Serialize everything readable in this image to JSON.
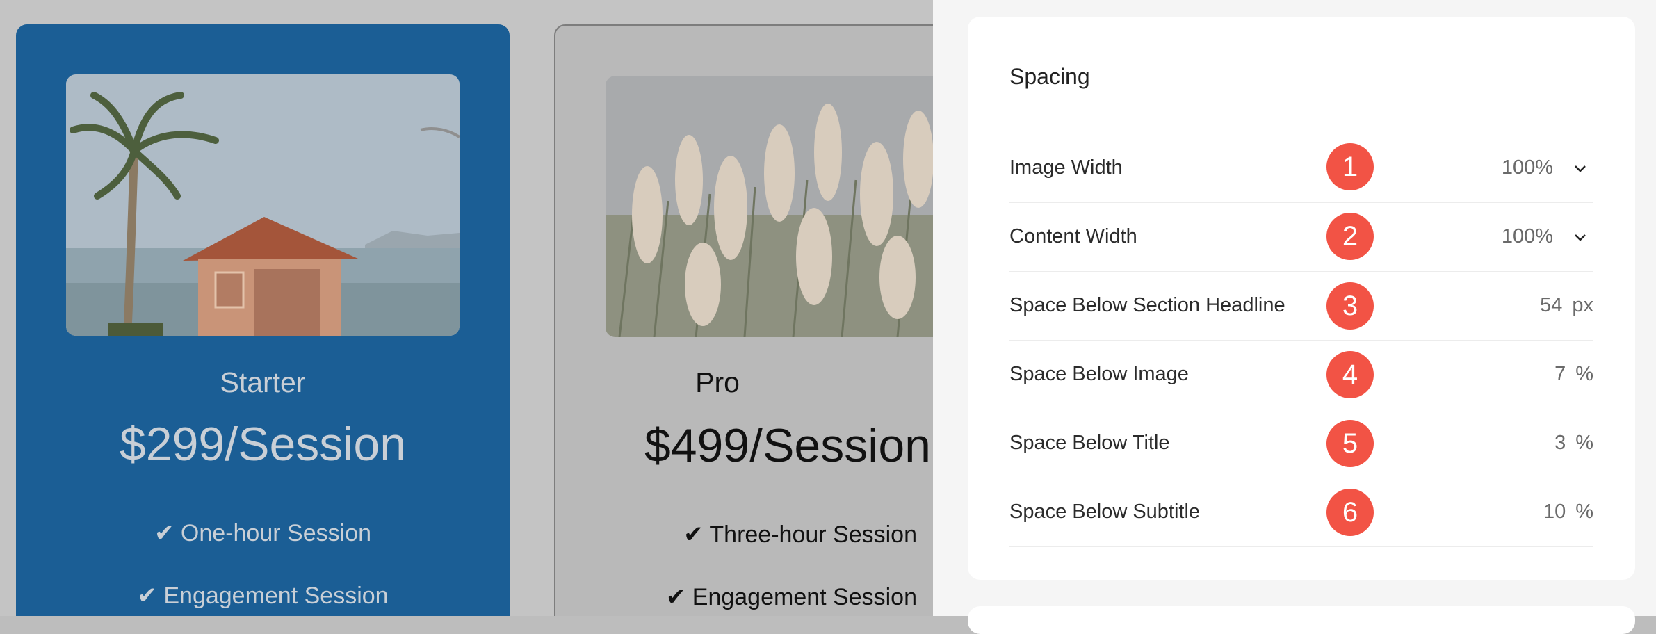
{
  "preview": {
    "cards": [
      {
        "title": "Starter",
        "price": "$299/Session",
        "features": [
          "✔ One-hour Session",
          "✔ Engagement Session"
        ]
      },
      {
        "title": "Pro",
        "price": "$499/Session",
        "features": [
          "✔ Three-hour Session",
          "✔ Engagement Session"
        ]
      }
    ],
    "colors": {
      "starter_bg": "#1b5e95",
      "badge": "#f25345"
    }
  },
  "panel": {
    "section_title": "Spacing",
    "rows": [
      {
        "label": "Image Width",
        "badge": "1",
        "value": "100%",
        "unit": "",
        "control": "dropdown",
        "icon": "chevron-down-icon"
      },
      {
        "label": "Content Width",
        "badge": "2",
        "value": "100%",
        "unit": "",
        "control": "dropdown",
        "icon": "chevron-down-icon"
      },
      {
        "label": "Space Below Section Headline",
        "badge": "3",
        "value": "54",
        "unit": "px",
        "control": "number"
      },
      {
        "label": "Space Below Image",
        "badge": "4",
        "value": "7",
        "unit": "%",
        "control": "number"
      },
      {
        "label": "Space Below Title",
        "badge": "5",
        "value": "3",
        "unit": "%",
        "control": "number"
      },
      {
        "label": "Space Below Subtitle",
        "badge": "6",
        "value": "10",
        "unit": "%",
        "control": "number"
      }
    ]
  }
}
